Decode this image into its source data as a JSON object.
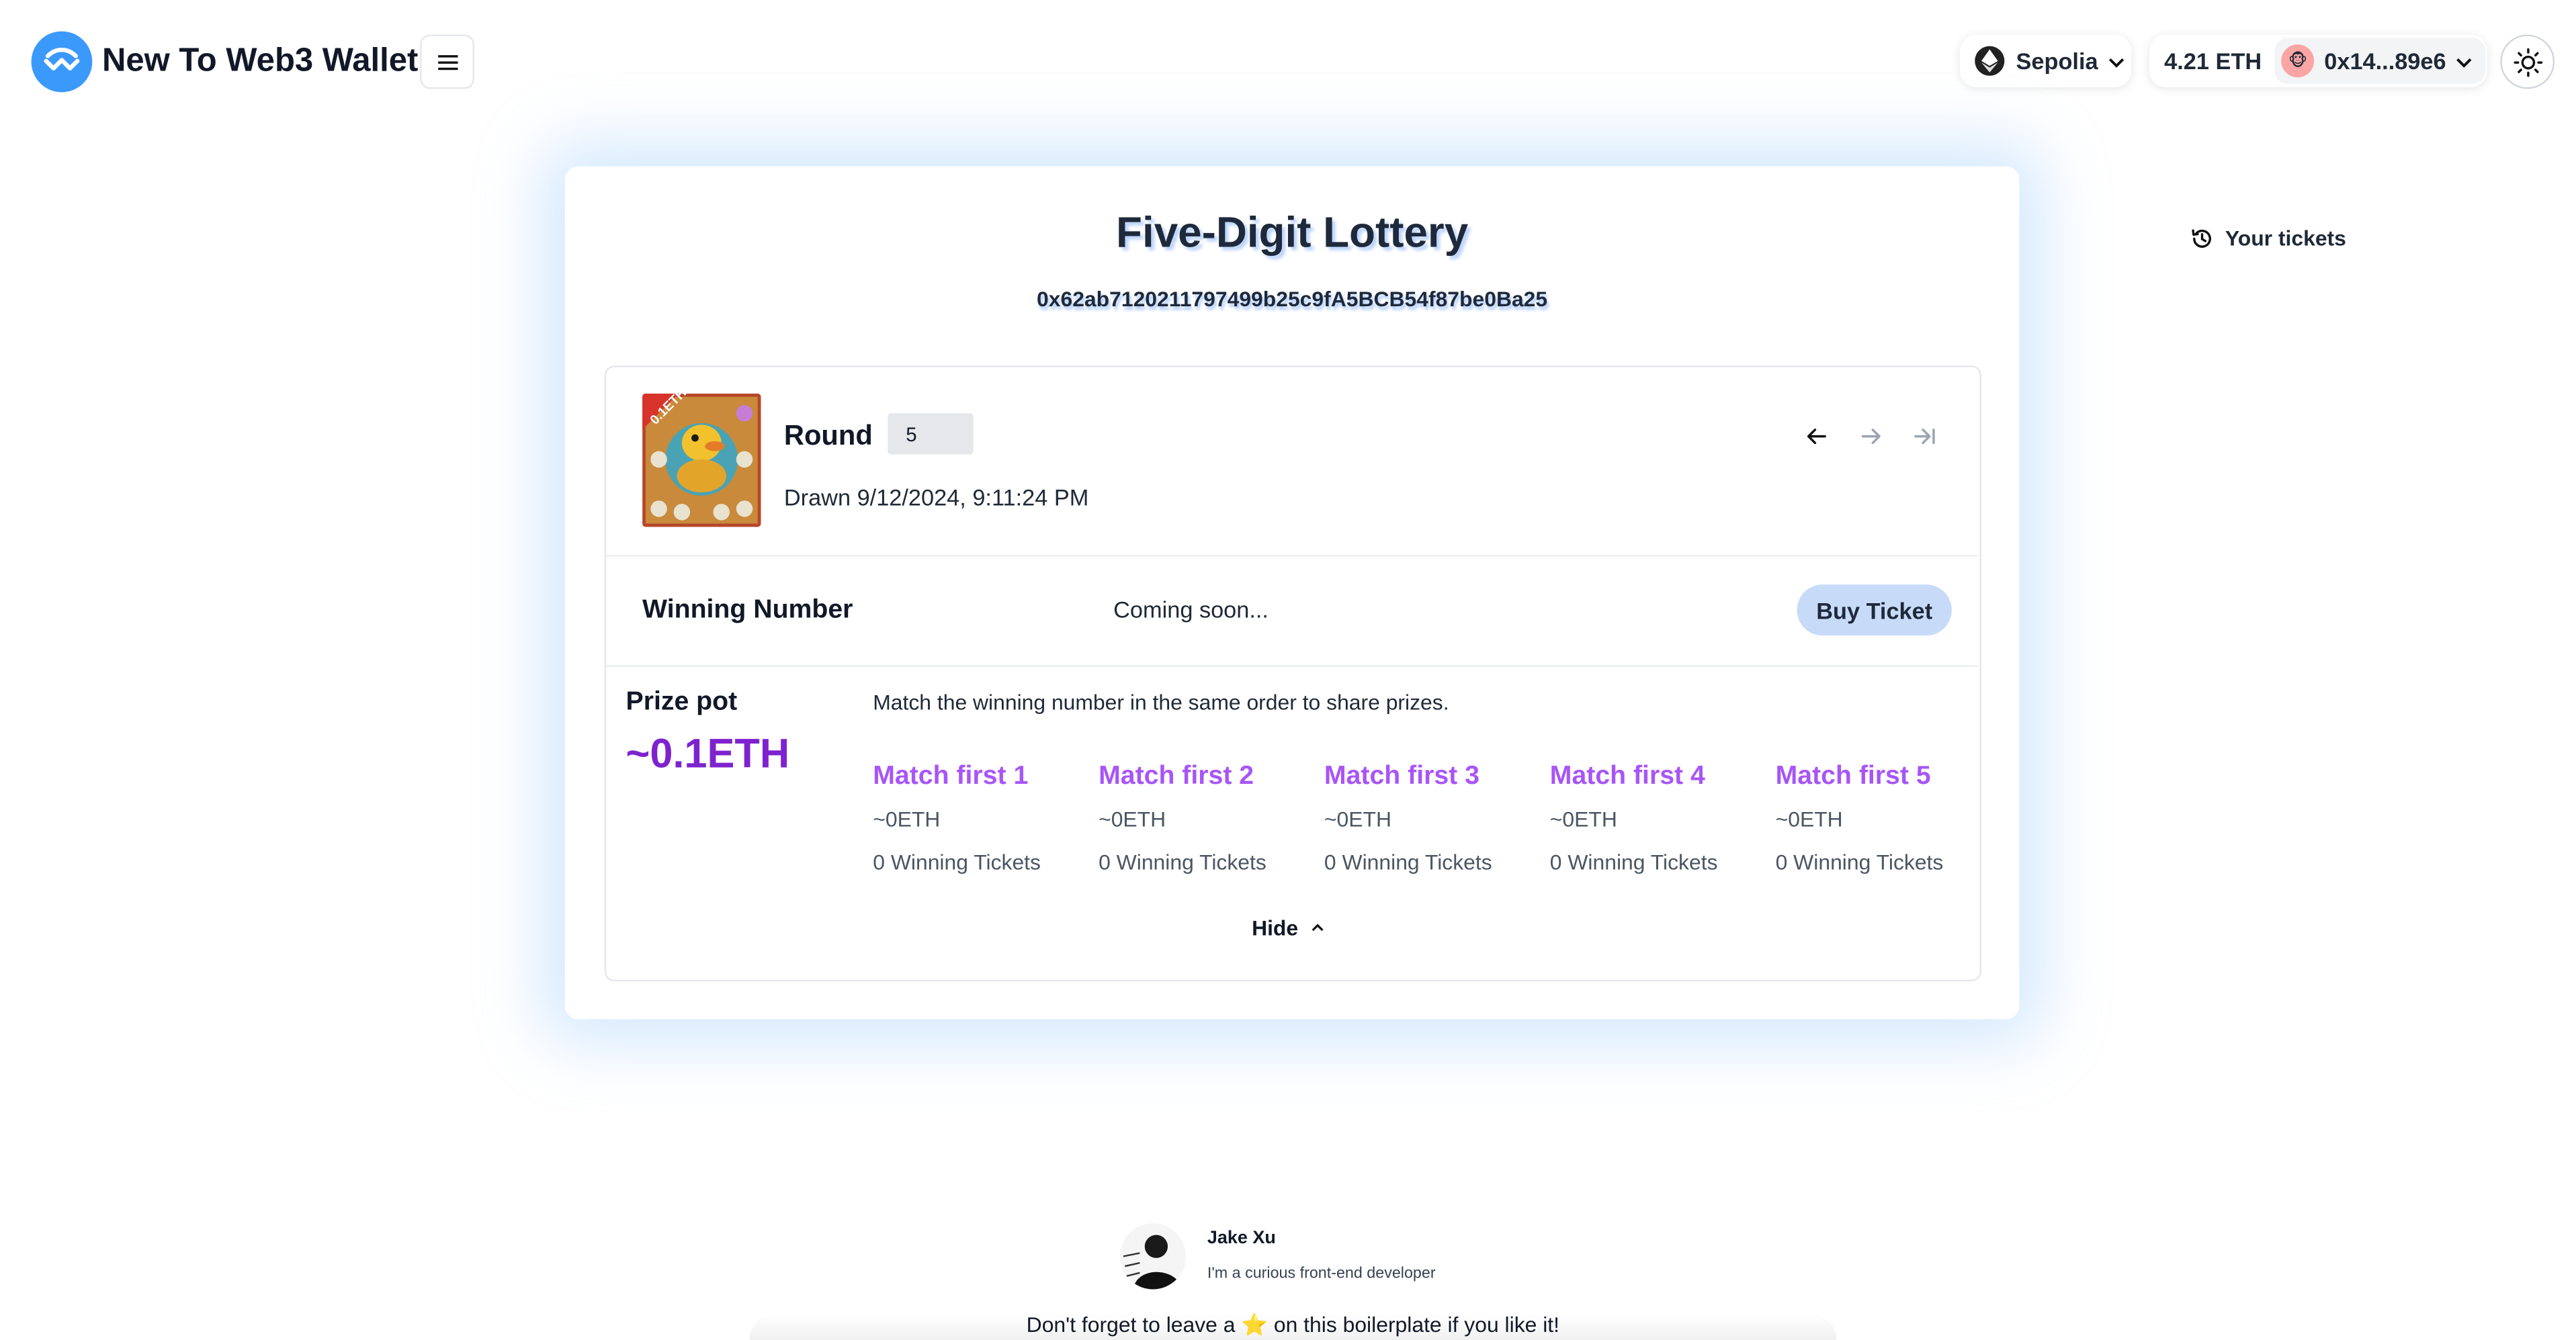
{
  "header": {
    "brand": "New To Web3 Wallet",
    "network": "Sepolia",
    "balance": "4.21 ETH",
    "account": "0x14...89e6"
  },
  "lottery": {
    "title": "Five-Digit Lottery",
    "contract": "0x62ab7120211797499b25c9fA5BCB54f87be0Ba25",
    "your_tickets": "Your tickets",
    "nft_badge": "0.1ETH",
    "round_label": "Round",
    "round_value": "5",
    "drawn": "Drawn 9/12/2024, 9:11:24 PM",
    "winning_label": "Winning Number",
    "winning_value": "Coming soon...",
    "buy_label": "Buy Ticket",
    "prize_label": "Prize pot",
    "prize_value": "~0.1ETH",
    "match_desc": "Match the winning number in the same order to share prizes.",
    "tiers": [
      {
        "title": "Match first 1",
        "eth": "~0ETH",
        "winners": "0 Winning Tickets"
      },
      {
        "title": "Match first 2",
        "eth": "~0ETH",
        "winners": "0 Winning Tickets"
      },
      {
        "title": "Match first 3",
        "eth": "~0ETH",
        "winners": "0 Winning Tickets"
      },
      {
        "title": "Match first 4",
        "eth": "~0ETH",
        "winners": "0 Winning Tickets"
      },
      {
        "title": "Match first 5",
        "eth": "~0ETH",
        "winners": "0 Winning Tickets"
      }
    ],
    "hide_label": "Hide"
  },
  "footer": {
    "author": "Jake Xu",
    "bio": "I'm a curious front-end developer",
    "message": "Don't forget to leave a ⭐ on this boilerplate if you like it!"
  },
  "icons": {
    "logo": "walletconnect-logo-icon",
    "menu": "hamburger-menu-icon",
    "network": "ethereum-icon",
    "theme": "sun-icon",
    "history": "history-icon",
    "prev": "arrow-left-icon",
    "next": "arrow-right-icon",
    "last": "arrow-to-end-icon"
  },
  "colors": {
    "accent_blue": "#3b99fc",
    "prize_purple": "#7e22ce",
    "tier_purple": "#a855f7",
    "buy_button_bg": "#c7dbf9"
  }
}
